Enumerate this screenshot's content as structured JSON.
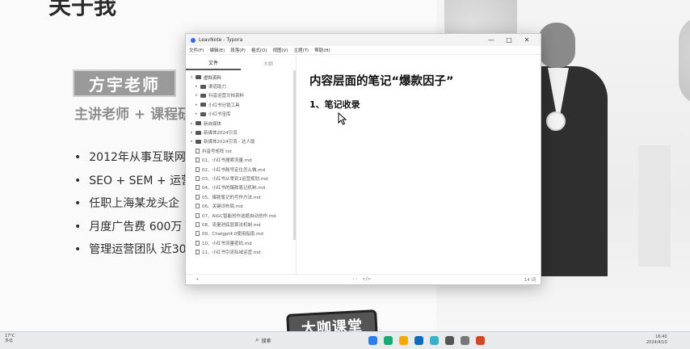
{
  "slide": {
    "title": "关于我",
    "name_badge": "方宇老师",
    "subtitle": "主讲老师 + 课程研",
    "bullets": [
      "2012年从事互联网",
      "SEO + SEM + 运营",
      "任职上海某龙头企",
      "月度广告费 600万",
      "管理运营团队 近30"
    ]
  },
  "watermark_logo": "大咖课堂",
  "window": {
    "title": "LeavNote - Typora",
    "controls": {
      "minimize": "—",
      "maximize": "□",
      "close": "✕"
    },
    "menu": [
      "文件(F)",
      "编辑(E)",
      "段落(P)",
      "格式(O)",
      "视图(V)",
      "主题(T)",
      "帮助(H)"
    ],
    "sidebar": {
      "tabs": [
        "文件",
        "大纲"
      ],
      "tree": [
        {
          "label": "虚拟资料",
          "type": "folder",
          "level": 0,
          "expanded": true
        },
        {
          "label": "渠道助力",
          "type": "folder",
          "level": 1
        },
        {
          "label": "抖音运营文档资料",
          "type": "folder",
          "level": 1
        },
        {
          "label": "小红书分销工具",
          "type": "folder",
          "level": 1
        },
        {
          "label": "小红书宝库",
          "type": "folder",
          "level": 1
        },
        {
          "label": "新自媒体",
          "type": "folder",
          "level": 0
        },
        {
          "label": "新媒体2024引流",
          "type": "folder",
          "level": 0
        },
        {
          "label": "新媒体2024引流 - 达人版",
          "type": "folder",
          "level": 0
        },
        {
          "label": "抖音号矩阵 txt",
          "type": "file",
          "level": 0
        },
        {
          "label": "01、小红书搜索流量.md",
          "type": "file",
          "level": 0
        },
        {
          "label": "02、小红书账号定位怎么做.md",
          "type": "file",
          "level": 0
        },
        {
          "label": "03、小红书从零到1运营规划.md",
          "type": "file",
          "level": 0
        },
        {
          "label": "04、小红书的爆款笔记机制.md",
          "type": "file",
          "level": 0
        },
        {
          "label": "05、爆款笔记的写作方法.md",
          "type": "file",
          "level": 0
        },
        {
          "label": "06、关键词布局.md",
          "type": "file",
          "level": 0
        },
        {
          "label": "07、AIGC智能创作选题自动创作.md",
          "type": "file",
          "level": 0
        },
        {
          "label": "08、流量池底层算法机制.md",
          "type": "file",
          "level": 0
        },
        {
          "label": "09、Chatgpt4.0使用指南.md",
          "type": "file",
          "level": 0
        },
        {
          "label": "10、小红书流量密码.md",
          "type": "file",
          "level": 0
        },
        {
          "label": "11、小红书引流私域运营.md",
          "type": "file",
          "level": 0
        }
      ]
    },
    "editor": {
      "heading": "内容层面的笔记“爆款因子”",
      "subheading": "1、笔记收录"
    },
    "status": {
      "left_add": "+",
      "nav": "‹ ›",
      "right_code": "</>",
      "words": "14 词"
    }
  },
  "taskbar": {
    "weather_temp": "17°C",
    "weather_desc": "多云",
    "search_placeholder": "搜索",
    "time": "16:40",
    "date": "2024/4/10",
    "app_colors": [
      "#2b7de9",
      "#19a974",
      "#f2a900",
      "#0f6cbd",
      "#3ab0c9",
      "#555555",
      "#777777",
      "#d24726"
    ]
  }
}
